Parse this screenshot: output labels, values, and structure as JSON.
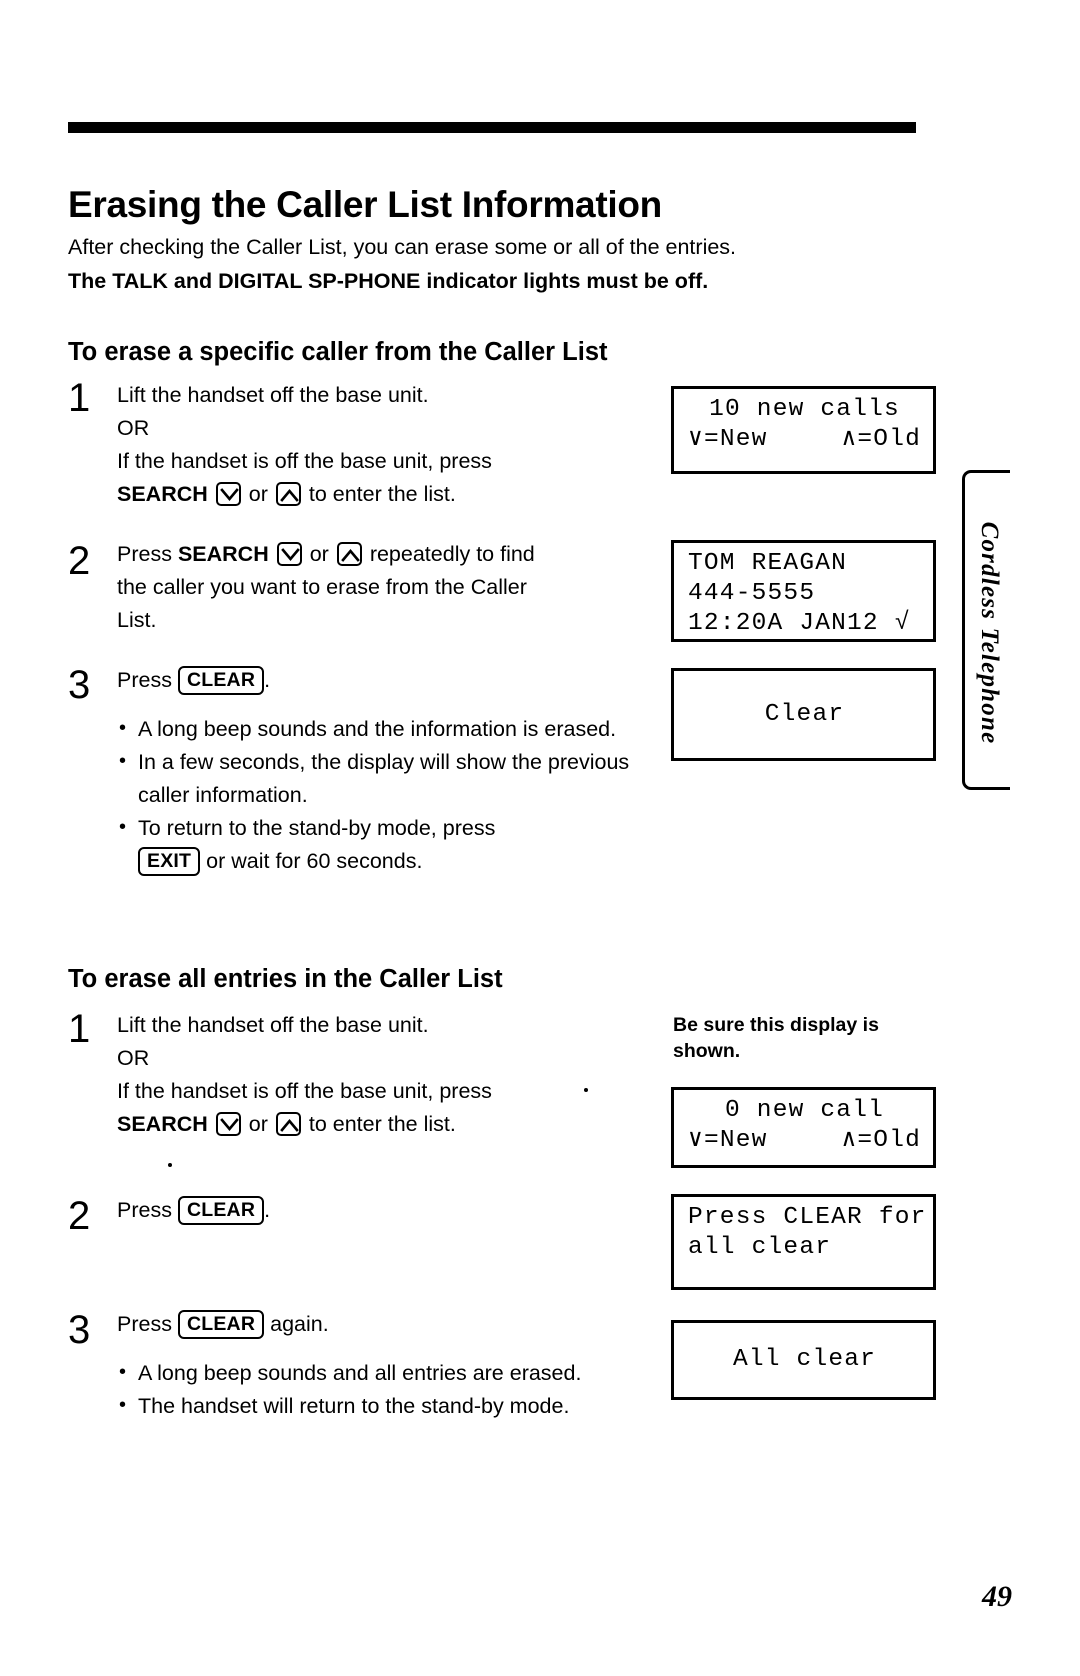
{
  "page": {
    "number": "49",
    "side_tab": "Cordless Telephone"
  },
  "heading": "Erasing the Caller List Information",
  "intro": {
    "line1": "After checking the Caller List, you can erase some or all of the entries.",
    "line2": "The TALK and DIGITAL SP-PHONE indicator lights must be off."
  },
  "section_a": {
    "heading": "To erase a specific caller from the Caller List",
    "steps": [
      {
        "number": "1",
        "lines": [
          "Lift the handset off the base unit.",
          "OR",
          "If the handset is off the base unit, press"
        ],
        "search_line": {
          "label": "SEARCH",
          "or": "or",
          "tail": "to enter the list.",
          "key_down": "down-arrow-key",
          "key_up": "up-arrow-key"
        }
      },
      {
        "number": "2",
        "press_prefix": "Press",
        "search_label": "SEARCH",
        "or": "or",
        "line1_tail": "repeatedly to find",
        "line2": "the caller you want to erase from the Caller",
        "line3": "List."
      },
      {
        "number": "3",
        "press_prefix": "Press",
        "button": "CLEAR",
        "press_suffix": ".",
        "bullets": [
          "A long beep sounds and the information is erased.",
          "In a few seconds, the display will show the previous caller information.",
          "To return to the stand-by mode, press"
        ],
        "exit_bullet": {
          "button": "EXIT",
          "tail": "or wait for 60 seconds."
        }
      }
    ],
    "displays": [
      {
        "name": "new-calls-display",
        "line1": "10 new calls",
        "line2_left": "∨=New",
        "line2_right": "∧=Old"
      },
      {
        "name": "caller-info-display",
        "line1": "TOM REAGAN",
        "line2": "444-5555",
        "line3": "12:20A JAN12 √"
      },
      {
        "name": "clear-display",
        "line1": "Clear"
      }
    ]
  },
  "section_b": {
    "heading": "To erase all entries in the Caller List",
    "caption": "Be sure this display is shown.",
    "steps": [
      {
        "number": "1",
        "lines": [
          "Lift the handset off the base unit.",
          "OR",
          "If the handset is off the base unit, press"
        ],
        "search_line": {
          "label": "SEARCH",
          "or": "or",
          "tail": "to enter the list.",
          "key_down": "down-arrow-key",
          "key_up": "up-arrow-key"
        }
      },
      {
        "number": "2",
        "press_prefix": "Press",
        "button": "CLEAR",
        "press_suffix": "."
      },
      {
        "number": "3",
        "press_prefix": "Press",
        "button": "CLEAR",
        "press_suffix": "again.",
        "bullets": [
          "A long beep sounds and all entries are erased.",
          "The handset will return to the stand-by mode."
        ]
      }
    ],
    "displays": [
      {
        "name": "zero-new-call-display",
        "line1": "0 new call",
        "line2_left": "∨=New",
        "line2_right": "∧=Old"
      },
      {
        "name": "press-clear-display",
        "line1": "Press CLEAR for",
        "line2": "all clear"
      },
      {
        "name": "all-clear-display",
        "line1": "All clear"
      }
    ]
  }
}
